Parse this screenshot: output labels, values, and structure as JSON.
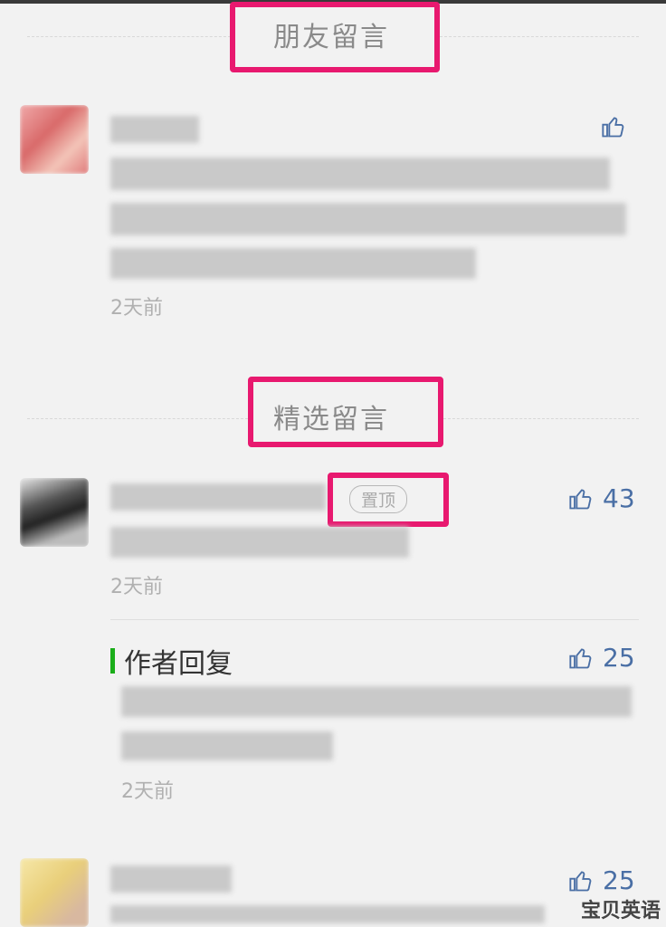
{
  "sections": {
    "friends_title": "朋友留言",
    "selected_title": "精选留言"
  },
  "friend_comment": {
    "time": "2天前"
  },
  "pinned_comment": {
    "badge": "置顶",
    "likes": "43",
    "time": "2天前"
  },
  "author_reply": {
    "label": "作者回复",
    "likes": "25",
    "time": "2天前"
  },
  "third_comment": {
    "likes": "25"
  },
  "watermark": "宝贝英语",
  "colors": {
    "highlight": "#e8196f",
    "accent_green": "#1aad19",
    "like_blue": "#4a6fa5"
  }
}
